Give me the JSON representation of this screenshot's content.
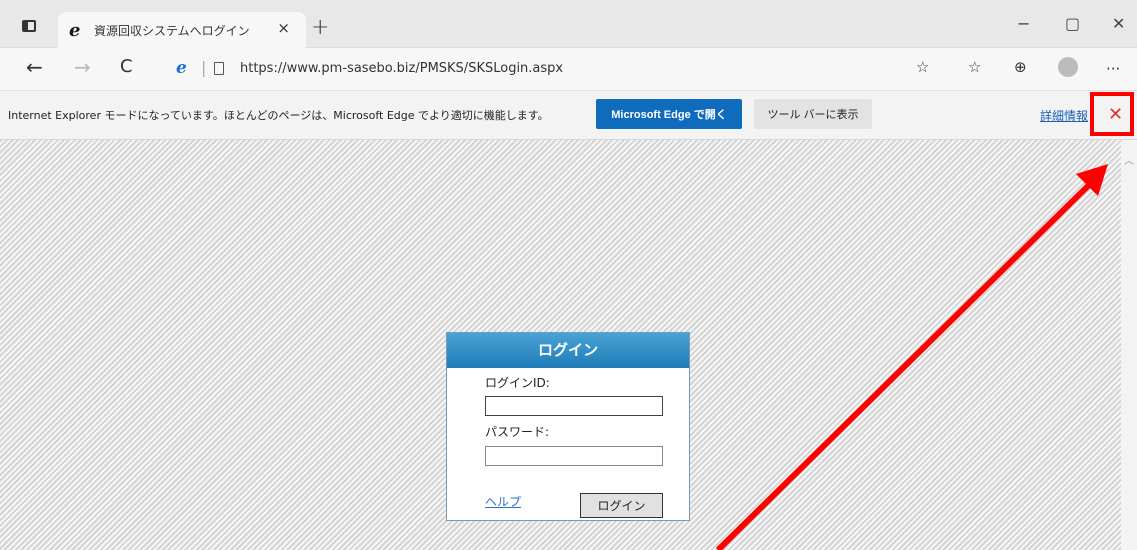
{
  "browser": {
    "tab": {
      "title": "資源回収システムへログイン",
      "close": "×",
      "favicon": "e"
    },
    "new_tab": "+",
    "window_controls": {
      "minimize": "−",
      "maximize": "▢",
      "close": "✕"
    },
    "nav": {
      "back": "←",
      "forward": "→",
      "refresh": "C"
    },
    "address": {
      "url": "https://www.pm-sasebo.biz/PMSKS/SKSLogin.aspx"
    },
    "more": "···"
  },
  "infobar": {
    "message": "Internet Explorer モードになっています。ほとんどのページは、Microsoft Edge でより適切に機能します。",
    "open_edge_label": "Microsoft Edge で開く",
    "show_toolbar_label": "ツール バーに表示",
    "details_link": "詳細情報",
    "close": "✕",
    "highlight_color": "#ff0000"
  },
  "login": {
    "header": "ログイン",
    "id_label": "ログインID:",
    "id_value": "",
    "password_label": "パスワード:",
    "password_value": "",
    "help_link": "ヘルプ",
    "submit_label": "ログイン"
  },
  "colors": {
    "accent": "#0f6cbd",
    "header_gradient_top": "#4aa3d5",
    "header_gradient_bottom": "#1e7bb6",
    "arrow": "#ff0000"
  }
}
